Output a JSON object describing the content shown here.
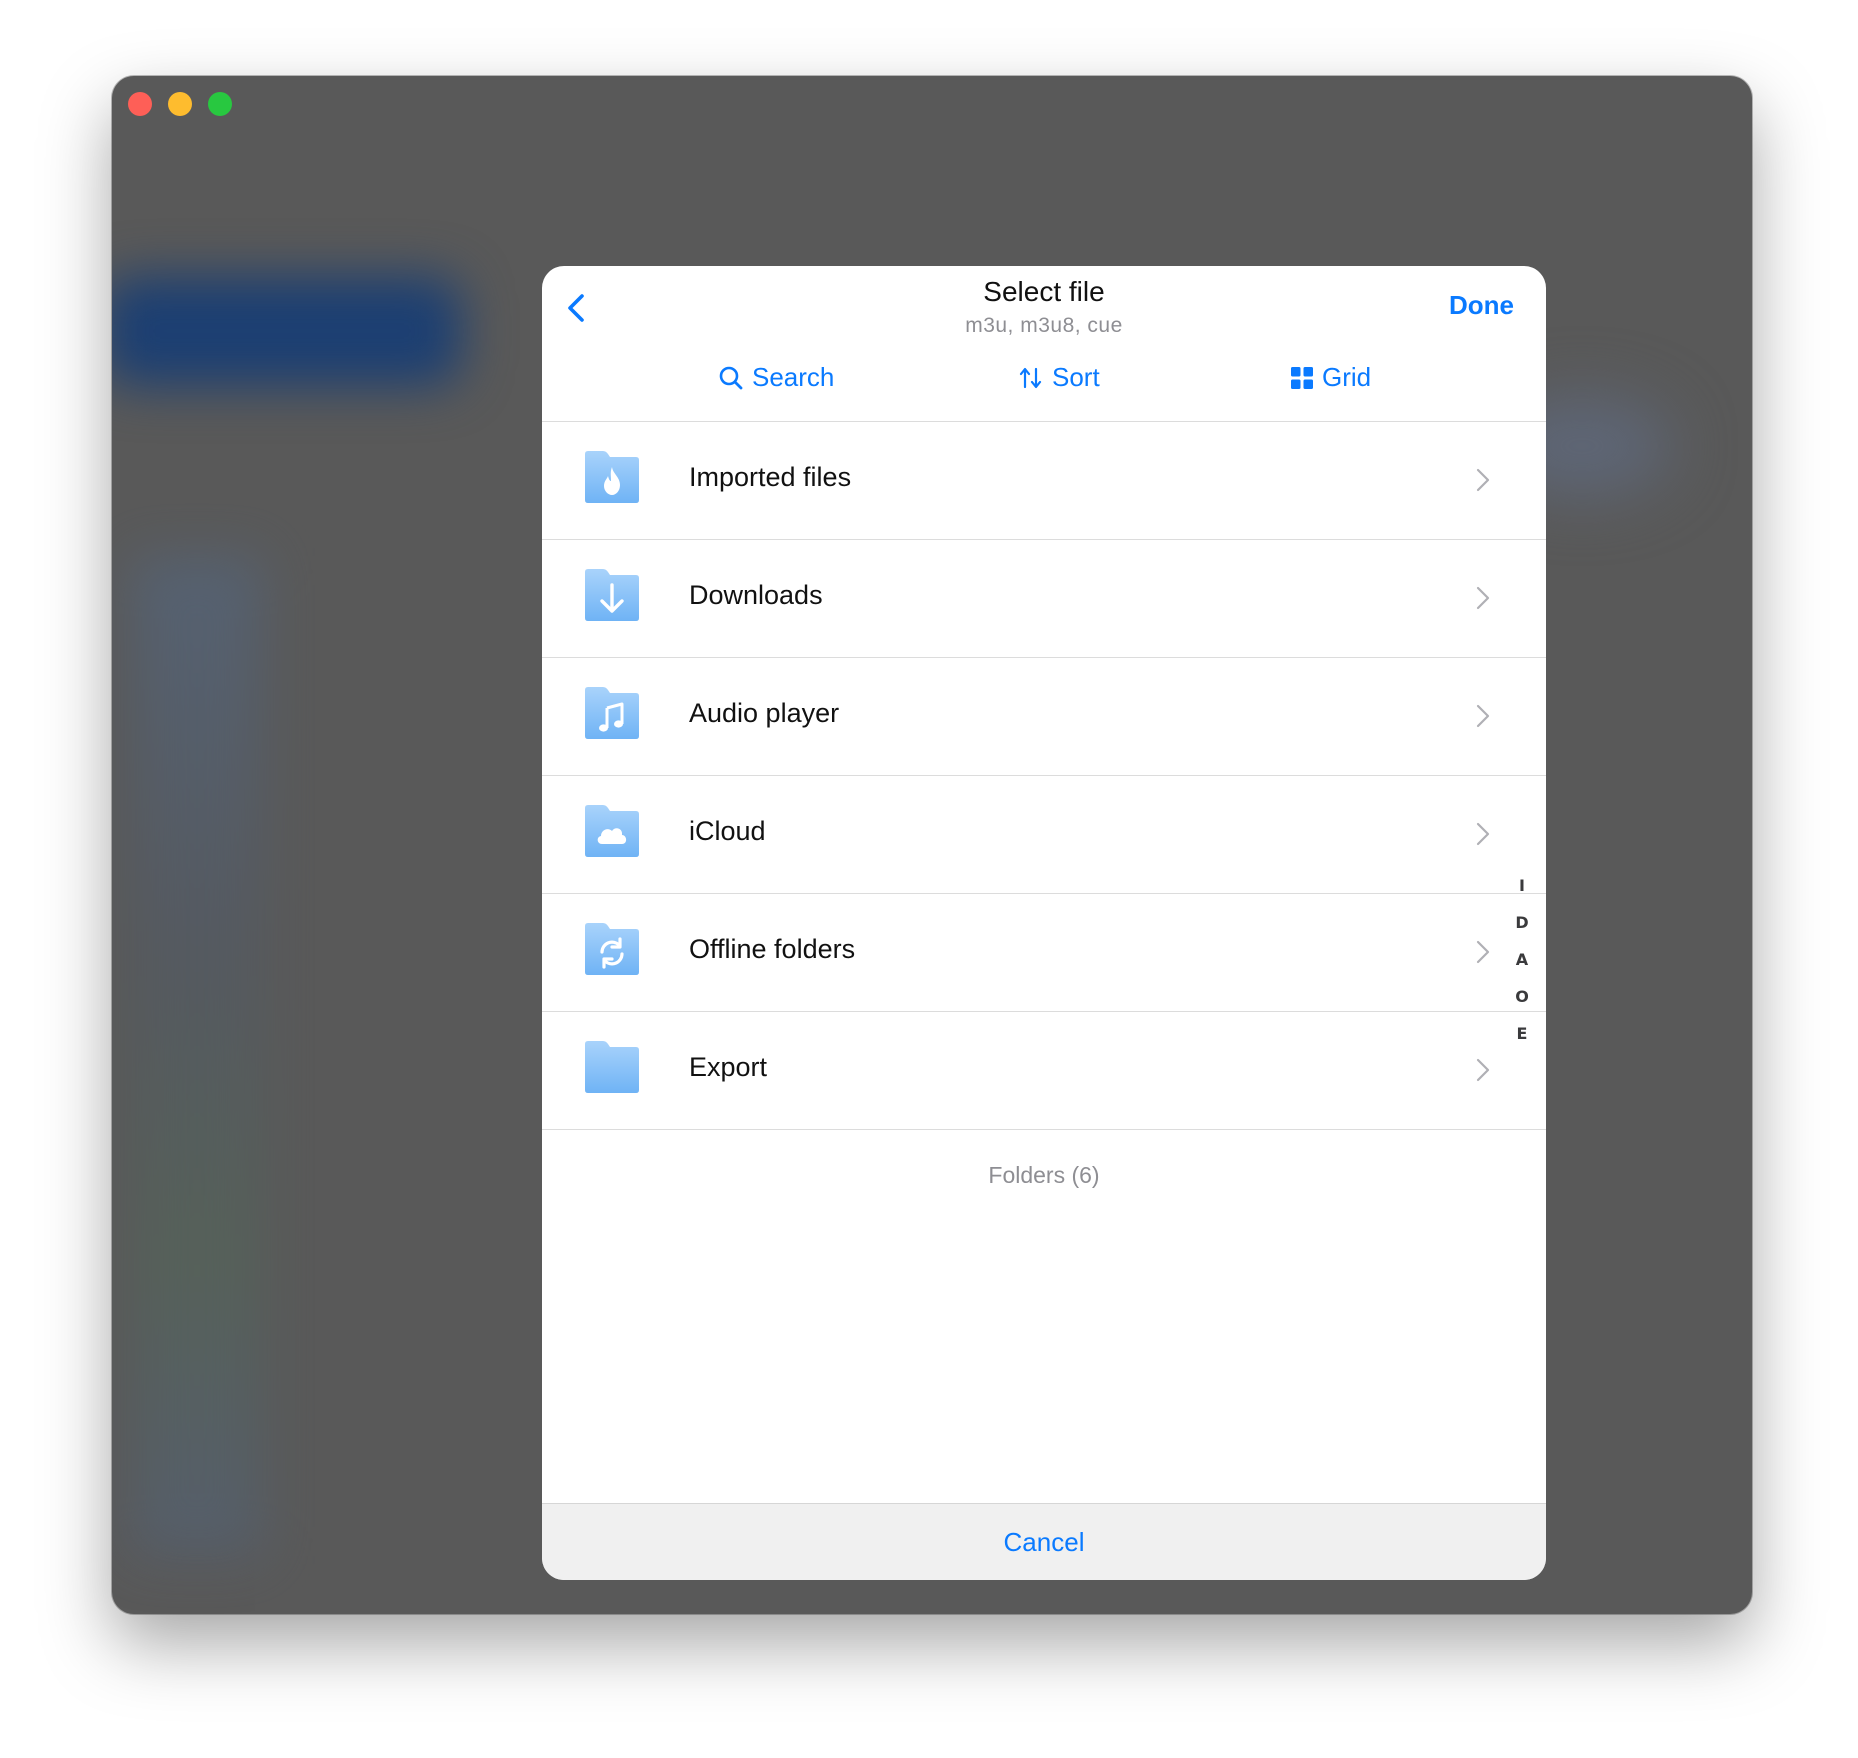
{
  "header": {
    "title": "Select file",
    "subtitle": "m3u, m3u8, cue",
    "done_label": "Done"
  },
  "toolbar": {
    "search_label": "Search",
    "sort_label": "Sort",
    "grid_label": "Grid"
  },
  "folders": [
    {
      "label": "Imported files",
      "icon": "flame-folder-icon"
    },
    {
      "label": "Downloads",
      "icon": "download-folder-icon"
    },
    {
      "label": "Audio player",
      "icon": "music-folder-icon"
    },
    {
      "label": "iCloud",
      "icon": "cloud-folder-icon"
    },
    {
      "label": "Offline folders",
      "icon": "sync-folder-icon"
    },
    {
      "label": "Export",
      "icon": "folder-icon"
    }
  ],
  "footer": {
    "count_text": "Folders (6)",
    "cancel_label": "Cancel"
  },
  "index_letters": [
    "I",
    "D",
    "A",
    "O",
    "E"
  ],
  "colors": {
    "accent": "#0a7aff",
    "folder_light": "#a9d3fb",
    "folder_dark": "#6fb3f5",
    "window_bg": "#595959"
  }
}
